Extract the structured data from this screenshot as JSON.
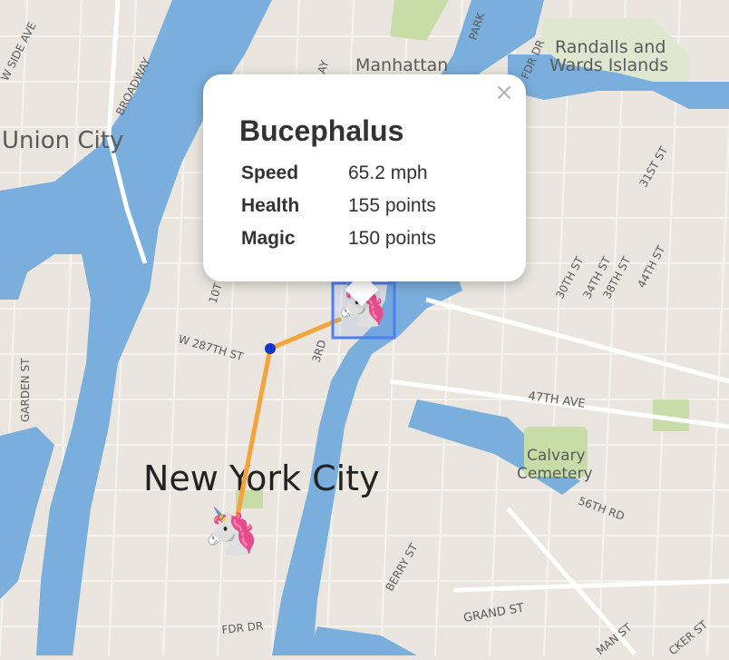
{
  "map": {
    "labels": {
      "manhattan": "Manhattan",
      "randalls1": "Randalls and",
      "randalls2": "Wards Islands",
      "union_city": "Union City",
      "nyc": "New York City",
      "broadway": "BROADWAY",
      "w_side_ave": "W SIDE AVE",
      "park": "PARK",
      "fdr_dr_top": "FDR DR",
      "fdr_dr_bottom": "FDR DR",
      "w287": "W 287TH ST",
      "third": "3RD",
      "tenth": "10T",
      "garden_st": "GARDEN ST",
      "ave_47": "47TH AVE",
      "calvary1": "Calvary",
      "calvary2": "Cemetery",
      "rd56": "56TH RD",
      "berry_st": "BERRY ST",
      "grand_st": "GRAND ST",
      "st31": "31ST ST",
      "st30": "30TH ST",
      "st34": "34TH ST",
      "st38": "38TH ST",
      "st44": "44TH ST",
      "man_st": "MAN ST",
      "cker_st": "CKER ST",
      "ay": "AY"
    }
  },
  "popup": {
    "title": "Bucephalus",
    "close_symbol": "×",
    "rows": [
      {
        "key": "Speed",
        "value": "65.2 mph"
      },
      {
        "key": "Health",
        "value": "155 points"
      },
      {
        "key": "Magic",
        "value": "150 points"
      }
    ]
  },
  "markers": {
    "unicorn_glyph": "🦄",
    "icon": "unicorn-icon"
  },
  "colors": {
    "water": "#7aaedc",
    "land": "#eae6df",
    "park": "#c8dca8",
    "route": "#f5a33b",
    "waypoint": "#1433c9",
    "selection": "#4d7ff0"
  }
}
